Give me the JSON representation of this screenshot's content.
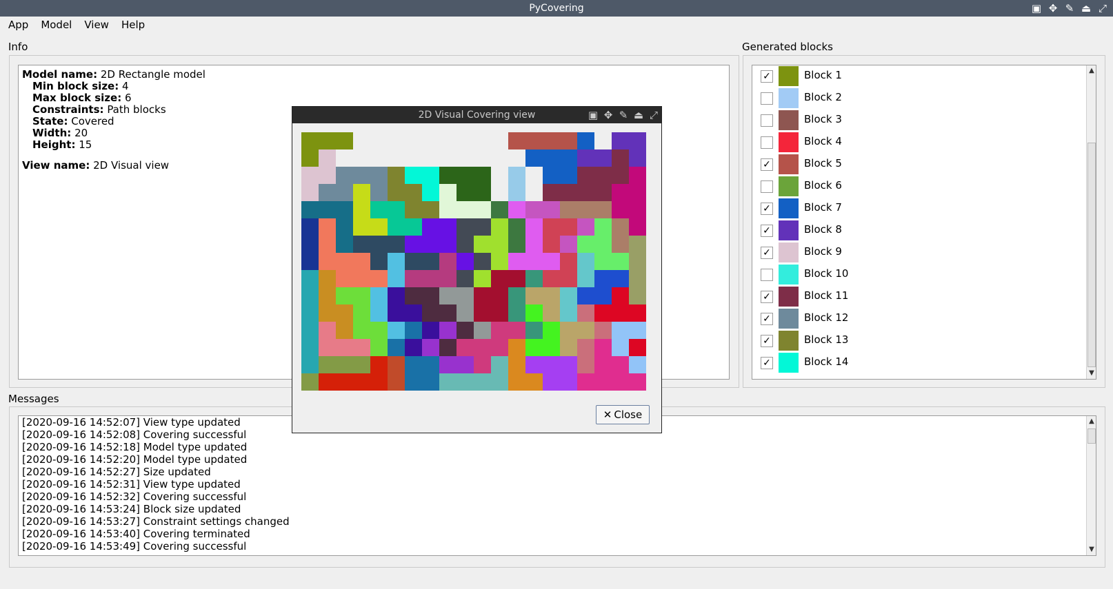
{
  "window": {
    "title": "PyCovering"
  },
  "menu": [
    "App",
    "Model",
    "View",
    "Help"
  ],
  "info": {
    "label": "Info",
    "model_name_key": "Model name:",
    "model_name": "2D Rectangle model",
    "min_block_key": "Min block size:",
    "min_block": "4",
    "max_block_key": "Max block size:",
    "max_block": "6",
    "constraints_key": "Constraints:",
    "constraints": "Path blocks",
    "state_key": "State:",
    "state": "Covered",
    "width_key": "Width:",
    "width": "20",
    "height_key": "Height:",
    "height": "15",
    "view_name_key": "View name:",
    "view_name": "2D Visual view"
  },
  "blocks": {
    "label": "Generated blocks",
    "items": [
      {
        "label": "Block 1",
        "color": "#7d9310",
        "checked": true
      },
      {
        "label": "Block 2",
        "color": "#a2cbf5",
        "checked": false
      },
      {
        "label": "Block 3",
        "color": "#8e5651",
        "checked": false
      },
      {
        "label": "Block 4",
        "color": "#f4253a",
        "checked": false
      },
      {
        "label": "Block 5",
        "color": "#b5534a",
        "checked": true
      },
      {
        "label": "Block 6",
        "color": "#6ba43a",
        "checked": false
      },
      {
        "label": "Block 7",
        "color": "#1360c4",
        "checked": true
      },
      {
        "label": "Block 8",
        "color": "#6232b9",
        "checked": true
      },
      {
        "label": "Block 9",
        "color": "#ddc4d1",
        "checked": true
      },
      {
        "label": "Block 10",
        "color": "#33eddd",
        "checked": false
      },
      {
        "label": "Block 11",
        "color": "#7e2d48",
        "checked": true
      },
      {
        "label": "Block 12",
        "color": "#6e8a9c",
        "checked": true
      },
      {
        "label": "Block 13",
        "color": "#7f842f",
        "checked": true
      },
      {
        "label": "Block 14",
        "color": "#03f7d7",
        "checked": true
      }
    ]
  },
  "messages": {
    "label": "Messages",
    "lines": [
      "[2020-09-16 14:52:07] View type updated",
      "[2020-09-16 14:52:08] Covering successful",
      "[2020-09-16 14:52:18] Model type updated",
      "[2020-09-16 14:52:20] Model type updated",
      "[2020-09-16 14:52:27] Size updated",
      "[2020-09-16 14:52:31] View type updated",
      "[2020-09-16 14:52:32] Covering successful",
      "[2020-09-16 14:53:24] Block size updated",
      "[2020-09-16 14:53:27] Constraint settings changed",
      "[2020-09-16 14:53:40] Covering terminated",
      "[2020-09-16 14:53:49] Covering successful"
    ]
  },
  "dialog": {
    "title": "2D Visual Covering view",
    "close_label": "Close",
    "grid": {
      "cols": 20,
      "rows": 15,
      "palette": {
        "a": "#7d9310",
        "b": "#ddc4d1",
        "c": "#b5534a",
        "d": "#1360c4",
        "e": "#6232b9",
        "f": "#6e8a9c",
        "g": "#7f842f",
        "h": "#03f7d7",
        "i": "#2c6519",
        "j": "#97cbe9",
        "k": "#7e2d48",
        "l": "#c2097a",
        "m": "#166e88",
        "n": "#c6dc18",
        "o": "#07c896",
        "p": "#e1f7d8",
        "q": "#3d7840",
        "r": "#df5cf0",
        "s": "#c555c0",
        "t": "#ab7e68",
        "u": "#183494",
        "v": "#f1785c",
        "w": "#2e4a62",
        "x": "#6711e4",
        "y": "#434a55",
        "z": "#a0e02e",
        "A": "#d04255",
        "B": "#67ee6a",
        "C": "#999f66",
        "D": "#52c0e2",
        "E": "#b53b7f",
        "F": "#a30f2f",
        "G": "#38967a",
        "H": "#64c7cb",
        "I": "#1e4ecf",
        "J": "#27a7b0",
        "K": "#c98e22",
        "L": "#6dde3a",
        "M": "#3a0f9c",
        "N": "#4e2c40",
        "O": "#929998",
        "P": "#baa569",
        "Q": "#dd0623",
        "R": "#e77b88",
        "S": "#1971a7",
        "T": "#9832ce",
        "U": "#cf3a7d",
        "V": "#44f320",
        "W": "#ca6f7b",
        "X": "#92c4f8",
        "Y": "#839b46",
        "Z": "#d52008",
        "0": "#c14b2a",
        "1": "#da891f",
        "2": "#68bab4",
        "3": "#a53ff2",
        "4": "#e02d8f",
        "5": "#78c9d2"
      },
      "rows_data": [
        "aaa.........ccccd.ee",
        "ab...........dddeeke",
        "bbfffghhiii.j.ddkkkl",
        "bffnfgghpii.j.kkkkll",
        "mmmnooggpppqrsstttll",
        "uvmnnooxxyyzqrAAsBtl",
        "uvmwwwxxxyzzqrAsBBtC",
        "uvvvwDwwExyzrrrAHBBC",
        "JKvvvDEEEyzFFGAAHIIC",
        "JKLLDMNNOOFFGPPHIIQC",
        "JKKLDMMNNOFFGVPHWQQQ",
        "JRKLLDSMTNOUUGVPPWXXQ",
        "JRRRLSMTNUUU1VVPW4XQ",
        "JYYYZ0SSTTU21333W44X",
        "YZZZZ0SS2222113344444"
      ]
    }
  }
}
